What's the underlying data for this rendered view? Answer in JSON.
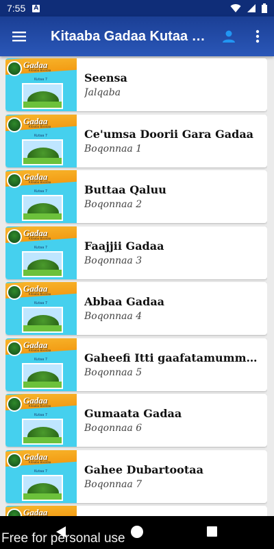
{
  "status_bar": {
    "time": "7:55",
    "badge": "A"
  },
  "app_bar": {
    "title": "Kitaaba Gadaa Kutaa 7..."
  },
  "thumbnail": {
    "brand": "Gadaa",
    "subtitle": "Kitaaba Barataa",
    "grade": "Kutaa 7"
  },
  "chapters": [
    {
      "title": "Seensa",
      "subtitle": "Jalqaba"
    },
    {
      "title": "Ce'umsa Doorii Gara Gadaa",
      "subtitle": "Boqonnaa 1"
    },
    {
      "title": "Buttaa Qaluu",
      "subtitle": "Boqonnaa 2"
    },
    {
      "title": "Faajjii Gadaa",
      "subtitle": "Boqonnaa 3"
    },
    {
      "title": "Abbaa Gadaa",
      "subtitle": "Boqonnaa 4"
    },
    {
      "title": "Gaheefi Itti gaafatamummaa...",
      "subtitle": "Boqonnaa 5"
    },
    {
      "title": "Gumaata Gadaa",
      "subtitle": "Boqonnaa 6"
    },
    {
      "title": "Gahee Dubartootaa",
      "subtitle": "Boqonnaa 7"
    }
  ],
  "watermark": "Free for personal use",
  "colors": {
    "app_bar": "#1b3f95",
    "status_bar": "#0f2d78",
    "accent_icon": "#2196f3"
  }
}
